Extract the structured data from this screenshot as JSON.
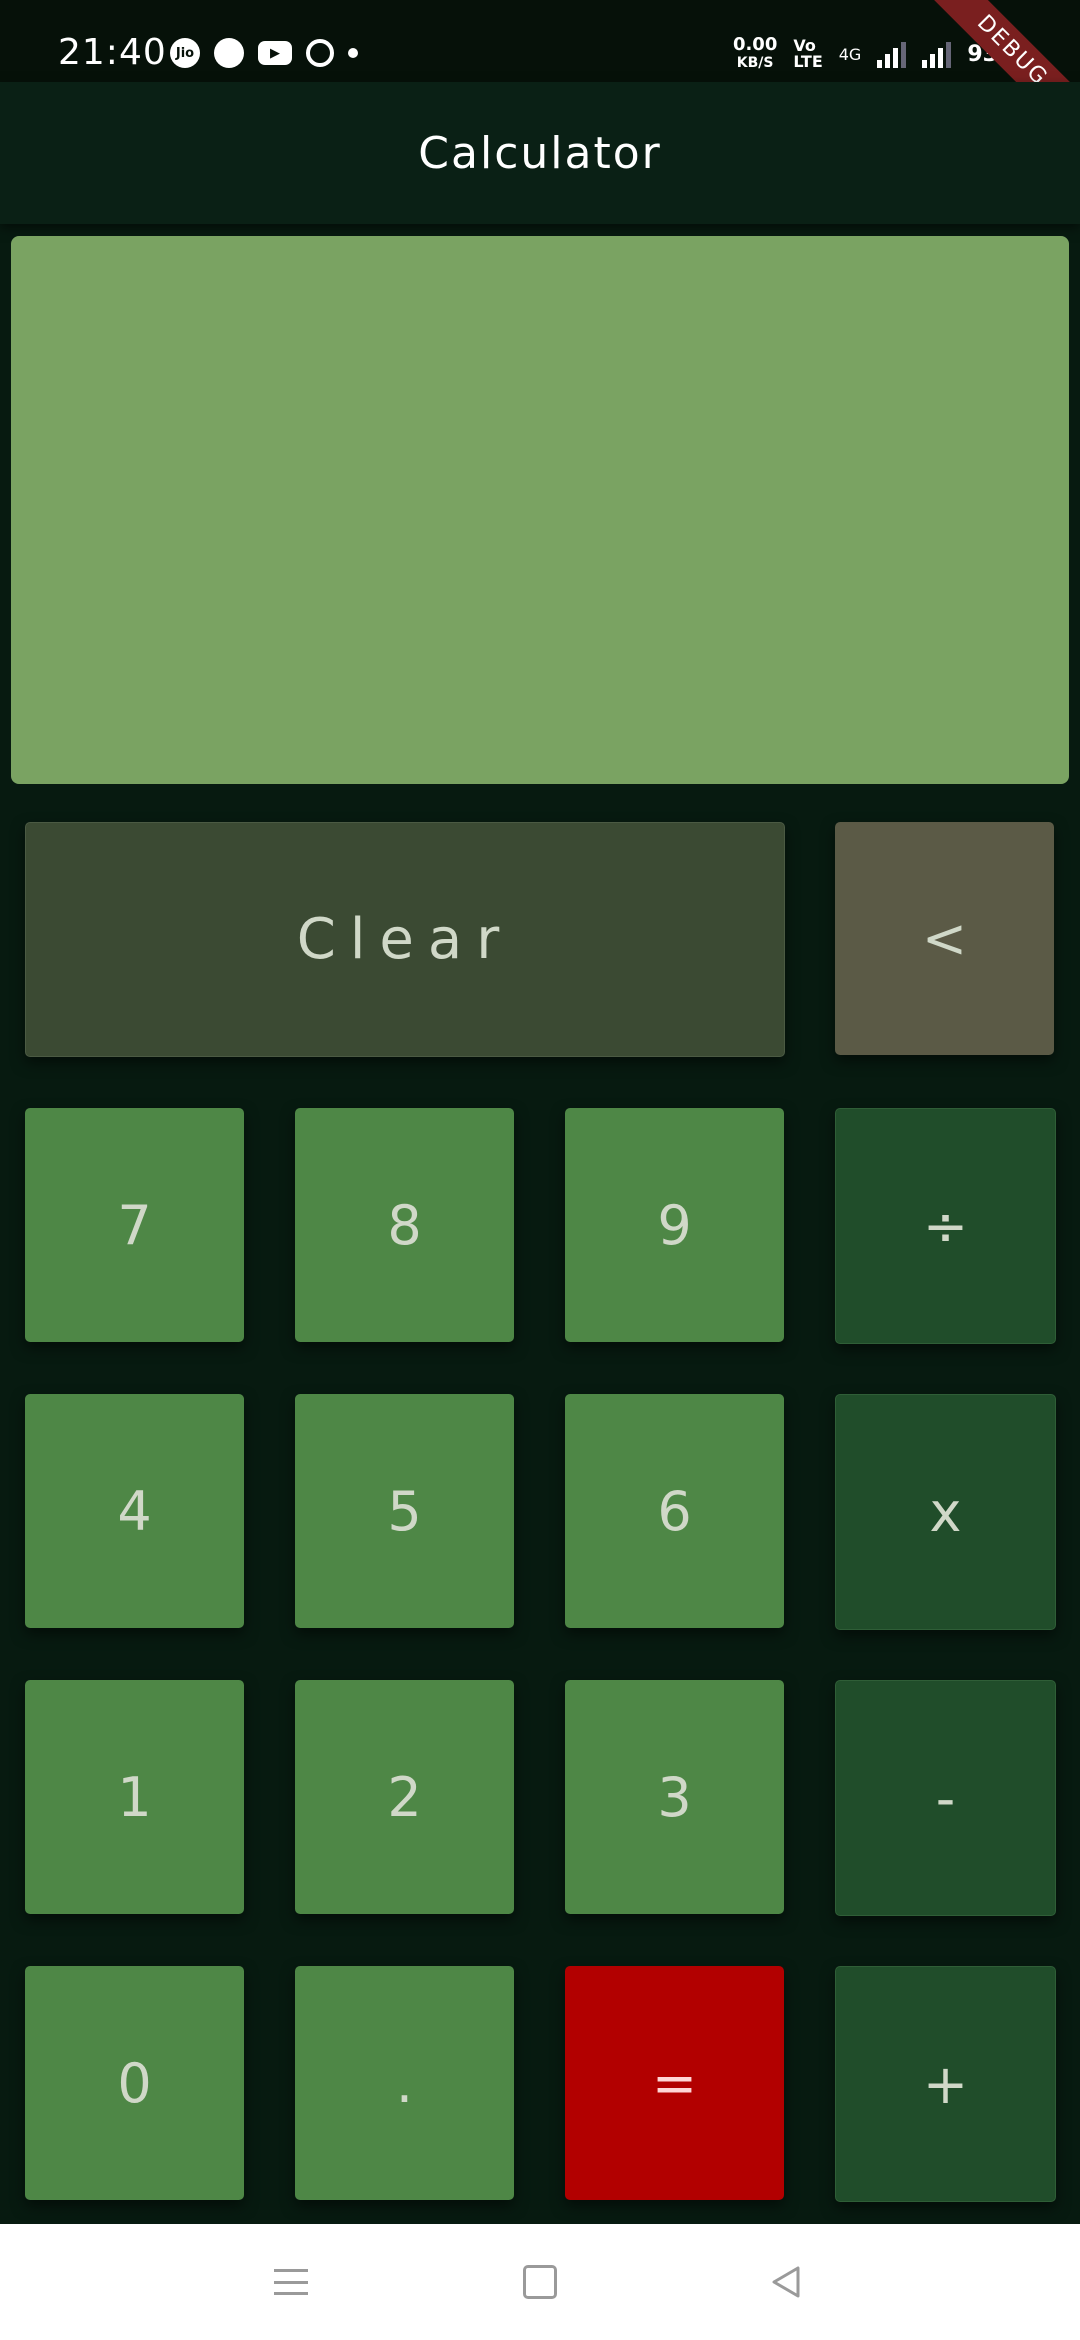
{
  "status_bar": {
    "time": "21:40",
    "speed_value": "0.00",
    "speed_unit": "KB/S",
    "volte_top": "Vo",
    "volte_bottom": "LTE",
    "network": "4G",
    "battery": "93%",
    "notif_jio": "Jio"
  },
  "debug_banner": "DEBUG",
  "app_bar": {
    "title": "Calculator"
  },
  "display": {
    "value": ""
  },
  "buttons": {
    "clear": "Clear",
    "backspace": "<",
    "seven": "7",
    "eight": "8",
    "nine": "9",
    "divide": "÷",
    "four": "4",
    "five": "5",
    "six": "6",
    "multiply": "x",
    "one": "1",
    "two": "2",
    "three": "3",
    "minus": "-",
    "zero": "0",
    "dot": ".",
    "equals": "=",
    "plus": "+"
  },
  "colors": {
    "background": "#071a10",
    "display": "#7aa362",
    "number_key": "#4e8746",
    "operator_key": "#204d2a",
    "clear_key": "#3b4a33",
    "backspace_key": "#5b5a46",
    "equals_key": "#b20000"
  },
  "nav_bar": {
    "icons": [
      "menu-icon",
      "home-square-icon",
      "back-triangle-icon"
    ]
  }
}
